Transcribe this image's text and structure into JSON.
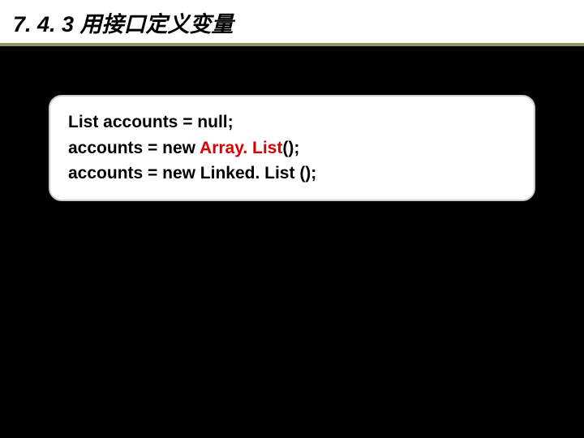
{
  "header": {
    "title": "7. 4. 3 用接口定义变量"
  },
  "code": {
    "line1": "List accounts = null;",
    "line2_pre": "accounts = new ",
    "line2_hl": "Array. List",
    "line2_post": "();",
    "line3": "accounts = new Linked. List ();"
  }
}
